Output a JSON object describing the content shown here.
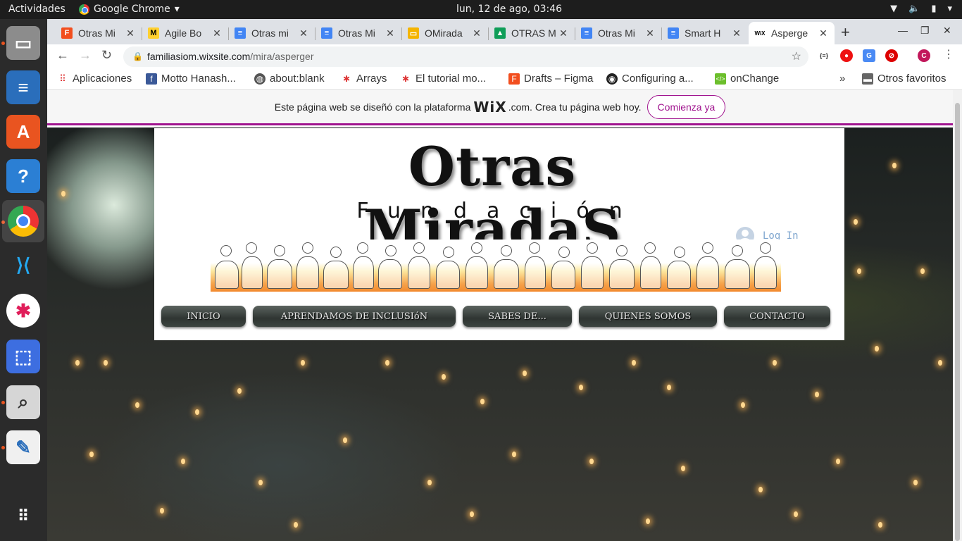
{
  "system": {
    "activities": "Actividades",
    "app_name": "Google Chrome",
    "clock": "lun, 12 de ago, 03:46"
  },
  "tabs": [
    {
      "label": "Otras Mi",
      "icon": "figma-icon",
      "color": "#f24e1e"
    },
    {
      "label": "Agile Bo",
      "icon": "miro-icon",
      "color": "#ffd02f"
    },
    {
      "label": "Otras mi",
      "icon": "docs-icon",
      "color": "#4285f4"
    },
    {
      "label": "Otras Mi",
      "icon": "docs-icon",
      "color": "#4285f4"
    },
    {
      "label": "OMirada",
      "icon": "slides-icon",
      "color": "#f4b400"
    },
    {
      "label": "OTRAS M",
      "icon": "drive-icon",
      "color": "#0f9d58"
    },
    {
      "label": "Otras Mi",
      "icon": "docs-icon",
      "color": "#4285f4"
    },
    {
      "label": "Smart H",
      "icon": "docs-icon",
      "color": "#4285f4"
    },
    {
      "label": "Asperge",
      "icon": "wix-icon",
      "color": "#000000"
    }
  ],
  "toolbar": {
    "url_host": "familiasiom.wixsite.com",
    "url_path": "/mira/asperger"
  },
  "bookmarks": [
    {
      "label": "Aplicaciones",
      "icon": "apps-grid-icon"
    },
    {
      "label": "Motto Hanash...",
      "icon": "facebook-icon"
    },
    {
      "label": "about:blank",
      "icon": "globe-icon"
    },
    {
      "label": "Arrays",
      "icon": "person-icon"
    },
    {
      "label": "El tutorial mo...",
      "icon": "person-icon"
    },
    {
      "label": "Drafts – Figma",
      "icon": "figma-icon"
    },
    {
      "label": "Configuring a...",
      "icon": "github-icon"
    },
    {
      "label": "onChange",
      "icon": "code-icon"
    }
  ],
  "bookmarks_overflow": "»",
  "other_bookmarks": "Otros favoritos",
  "wix_banner": {
    "text_before": "Este página web se diseñó con la plataforma",
    "logo": "WiX",
    "text_after": ".com. Crea tu página web hoy.",
    "cta": "Comienza ya"
  },
  "site": {
    "title": "Otras MiradaS",
    "subtitle": "Fundación",
    "login": "Log In",
    "nav": [
      "INICIO",
      "APRENDAMOS DE INCLUSIóN",
      "SABES DE...",
      "QUIENES SOMOS",
      "CONTACTO"
    ]
  },
  "extension_badge": "C",
  "colors": {
    "wix_accent": "#a0138e",
    "login_text": "#7fa6cf"
  }
}
